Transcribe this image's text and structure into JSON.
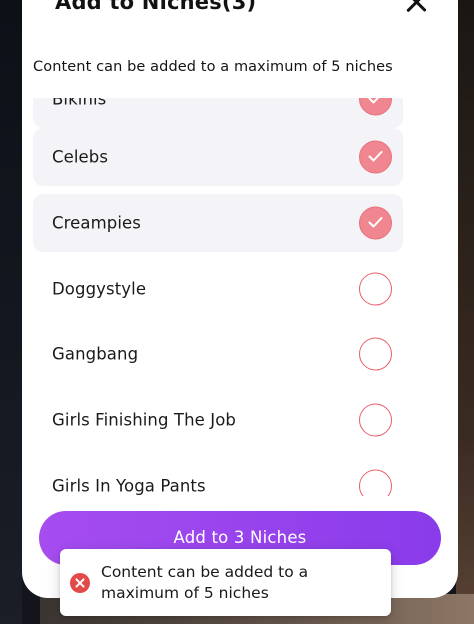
{
  "header": {
    "title": "Add to Niches(3)"
  },
  "subtitle": "Content can be added to a maximum of 5 niches",
  "niches": [
    {
      "label": "Bikinis",
      "selected": true
    },
    {
      "label": "Celebs",
      "selected": true
    },
    {
      "label": "Creampies",
      "selected": true
    },
    {
      "label": "Doggystyle",
      "selected": false
    },
    {
      "label": "Gangbang",
      "selected": false
    },
    {
      "label": "Girls Finishing The Job",
      "selected": false
    },
    {
      "label": "Girls In Yoga Pants",
      "selected": false
    }
  ],
  "cta": {
    "label": "Add to 3 Niches"
  },
  "toast": {
    "message": "Content can be added to a maximum of 5 niches",
    "icon": "error-icon"
  },
  "colors": {
    "accent": "#9b45ee",
    "check_on": "#f0868f",
    "check_border": "#e6606c",
    "error": "#e34949",
    "selected_row": "#f3f3f8"
  }
}
